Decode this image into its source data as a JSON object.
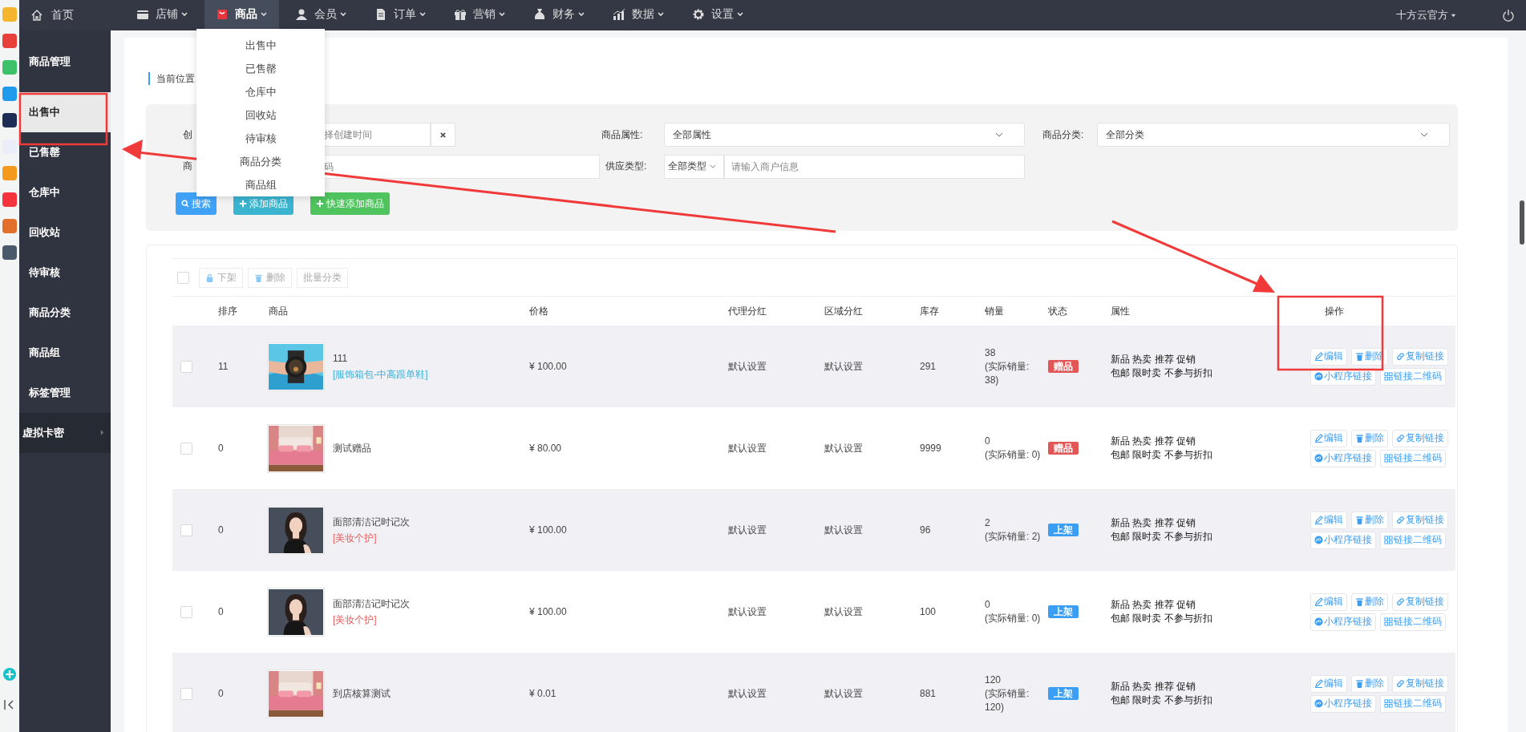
{
  "top_nav": {
    "home": "首页",
    "items": [
      {
        "label": "店铺",
        "selected": false
      },
      {
        "label": "商品",
        "selected": true
      },
      {
        "label": "会员",
        "selected": false
      },
      {
        "label": "订单",
        "selected": false
      },
      {
        "label": "营销",
        "selected": false
      },
      {
        "label": "财务",
        "selected": false
      },
      {
        "label": "数据",
        "selected": false
      },
      {
        "label": "设置",
        "selected": false
      }
    ],
    "user": "十方云官方"
  },
  "sidebar": {
    "items": [
      {
        "kind": "heading",
        "label": "商品管理",
        "selected": false
      },
      {
        "kind": "item",
        "label": "出售中",
        "selected": true
      },
      {
        "kind": "item",
        "label": "已售罄",
        "selected": false
      },
      {
        "kind": "item",
        "label": "仓库中",
        "selected": false
      },
      {
        "kind": "item",
        "label": "回收站",
        "selected": false
      },
      {
        "kind": "item",
        "label": "待审核",
        "selected": false
      },
      {
        "kind": "item",
        "label": "商品分类",
        "selected": false
      },
      {
        "kind": "item",
        "label": "商品组",
        "selected": false
      },
      {
        "kind": "item",
        "label": "标签管理",
        "selected": false
      },
      {
        "kind": "submenu",
        "label": "虚拟卡密",
        "selected": false
      }
    ]
  },
  "dropdown": {
    "items": [
      "出售中",
      "已售罄",
      "仓库中",
      "回收站",
      "待审核",
      "商品分类",
      "商品组"
    ]
  },
  "breadcrumb": "当前位置",
  "filters": {
    "created": {
      "label": "创",
      "placeholder": "择创建时间"
    },
    "attribute": {
      "label": "商品属性:",
      "value": "全部属性"
    },
    "category": {
      "label": "商品分类:",
      "value": "全部分类"
    },
    "name": {
      "label": "商",
      "placeholder": "码"
    },
    "supply": {
      "label": "供应类型:",
      "type": "全部类型",
      "placeholder": "请输入商户信息"
    },
    "buttons": [
      {
        "kind": "search",
        "label": "搜索"
      },
      {
        "kind": "add",
        "label": "添加商品"
      },
      {
        "kind": "quick",
        "label": "快速添加商品"
      }
    ]
  },
  "table": {
    "select_all": {
      "checked": false
    },
    "toolbar": [
      {
        "label": "下架",
        "disabled": true
      },
      {
        "label": "删除",
        "disabled": true
      },
      {
        "label": "批量分类",
        "disabled": true
      }
    ],
    "columns": [
      "排序",
      "商品",
      "价格",
      "代理分红",
      "区域分红",
      "库存",
      "销量",
      "状态",
      "属性",
      "操作"
    ],
    "rows": [
      {
        "checked": false,
        "sort": "11",
        "name": "111",
        "category": {
          "text": "[服饰箱包-中高跟单鞋]",
          "color": "#3ab0d8"
        },
        "price": "¥ 100.00",
        "agent_bonus": "默认设置",
        "region_bonus": "默认设置",
        "stock": "291",
        "sales": "38",
        "actual_sales": "(实际销量: 38)",
        "status": {
          "kind": "gift",
          "text": "赠品"
        },
        "attributes": [
          "新品 热卖 推荐 促销",
          "包邮 限时卖 不参与折扣"
        ],
        "actions": [
          "编辑",
          "删除",
          "复制链接",
          "小程序链接",
          "链接二维码"
        ]
      },
      {
        "checked": false,
        "sort": "0",
        "name": "测试赠品",
        "price": "¥ 80.00",
        "agent_bonus": "默认设置",
        "region_bonus": "默认设置",
        "stock": "9999",
        "sales": "0",
        "actual_sales": "(实际销量: 0)",
        "status": {
          "kind": "gift",
          "text": "赠品"
        },
        "attributes": [
          "新品 热卖 推荐 促销",
          "包邮 限时卖 不参与折扣"
        ],
        "actions": [
          "编辑",
          "删除",
          "复制链接",
          "小程序链接",
          "链接二维码"
        ]
      },
      {
        "checked": false,
        "sort": "0",
        "name": "面部清洁记时记次",
        "category": {
          "text": "[美妆个护]",
          "color": "#e85c5c"
        },
        "price": "¥ 100.00",
        "agent_bonus": "默认设置",
        "region_bonus": "默认设置",
        "stock": "96",
        "sales": "2",
        "actual_sales": "(实际销量: 2)",
        "status": {
          "kind": "on",
          "text": "上架"
        },
        "attributes": [
          "新品 热卖 推荐 促销",
          "包邮 限时卖 不参与折扣"
        ],
        "actions": [
          "编辑",
          "删除",
          "复制链接",
          "小程序链接",
          "链接二维码"
        ]
      },
      {
        "checked": false,
        "sort": "0",
        "name": "面部清洁记时记次",
        "category": {
          "text": "[美妆个护]",
          "color": "#e85c5c"
        },
        "price": "¥ 100.00",
        "agent_bonus": "默认设置",
        "region_bonus": "默认设置",
        "stock": "100",
        "sales": "0",
        "actual_sales": "(实际销量: 0)",
        "status": {
          "kind": "on",
          "text": "上架"
        },
        "attributes": [
          "新品 热卖 推荐 促销",
          "包邮 限时卖 不参与折扣"
        ],
        "actions": [
          "编辑",
          "删除",
          "复制链接",
          "小程序链接",
          "链接二维码"
        ]
      },
      {
        "checked": false,
        "sort": "0",
        "name": "到店核算测试",
        "price": "¥ 0.01",
        "agent_bonus": "默认设置",
        "region_bonus": "默认设置",
        "stock": "881",
        "sales": "120",
        "actual_sales": "(实际销量: 120)",
        "status": {
          "kind": "on",
          "text": "上架"
        },
        "attributes": [
          "新品 热卖 推荐 促销",
          "包邮 限时卖 不参与折扣"
        ],
        "actions": [
          "编辑",
          "删除",
          "复制链接",
          "小程序链接",
          "链接二维码"
        ]
      }
    ]
  }
}
